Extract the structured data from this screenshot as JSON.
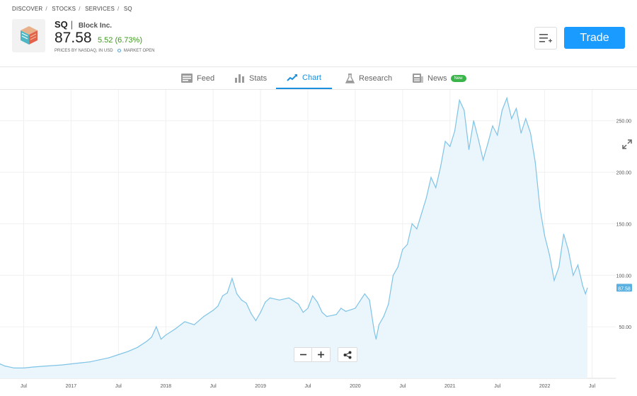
{
  "breadcrumb": [
    "DISCOVER",
    "STOCKS",
    "SERVICES",
    "SQ"
  ],
  "instrument": {
    "symbol": "SQ",
    "name": "Block Inc.",
    "price": "87.58",
    "change": "5.52 (6.73%)",
    "price_source": "PRICES BY NASDAQ, IN USD",
    "market_status": "MARKET OPEN"
  },
  "actions": {
    "trade_label": "Trade",
    "watchlist_icon": "add-to-list-icon"
  },
  "tabs": [
    {
      "label": "Feed",
      "icon": "feed-icon",
      "active": false
    },
    {
      "label": "Stats",
      "icon": "stats-icon",
      "active": false
    },
    {
      "label": "Chart",
      "icon": "chart-icon",
      "active": true
    },
    {
      "label": "Research",
      "icon": "research-icon",
      "active": false
    },
    {
      "label": "News",
      "icon": "news-icon",
      "active": false,
      "badge": "New"
    }
  ],
  "colors": {
    "accent": "#1a9bff",
    "positive": "#3d9a1d",
    "line": "#7fc3e6",
    "fill": "#eaf5fc",
    "badge": "#3ab54a"
  },
  "chart_data": {
    "type": "area",
    "x_unit": "year (decimal)",
    "x_ticks": [
      "Jul",
      "2017",
      "Jul",
      "2018",
      "Jul",
      "2019",
      "Jul",
      "2020",
      "Jul",
      "2021",
      "Jul",
      "2022",
      "Jul"
    ],
    "x_tick_values": [
      2016.5,
      2017.0,
      2017.5,
      2018.0,
      2018.5,
      2019.0,
      2019.5,
      2020.0,
      2020.5,
      2021.0,
      2021.5,
      2022.0,
      2022.5
    ],
    "y_ticks": [
      "50.00",
      "100.00",
      "150.00",
      "200.00",
      "250.00"
    ],
    "y_tick_values": [
      50,
      100,
      150,
      200,
      250
    ],
    "xlim": [
      2016.25,
      2022.75
    ],
    "ylim": [
      0,
      280
    ],
    "last_value_label": "87.58",
    "grid": true,
    "points": [
      [
        2016.25,
        14
      ],
      [
        2016.3,
        12
      ],
      [
        2016.4,
        10
      ],
      [
        2016.5,
        10
      ],
      [
        2016.6,
        11
      ],
      [
        2016.75,
        12
      ],
      [
        2016.9,
        13
      ],
      [
        2017.0,
        14
      ],
      [
        2017.1,
        15
      ],
      [
        2017.2,
        16
      ],
      [
        2017.3,
        18
      ],
      [
        2017.4,
        20
      ],
      [
        2017.5,
        23
      ],
      [
        2017.6,
        26
      ],
      [
        2017.7,
        30
      ],
      [
        2017.8,
        36
      ],
      [
        2017.85,
        40
      ],
      [
        2017.9,
        50
      ],
      [
        2017.95,
        38
      ],
      [
        2018.0,
        42
      ],
      [
        2018.1,
        48
      ],
      [
        2018.2,
        55
      ],
      [
        2018.3,
        52
      ],
      [
        2018.4,
        60
      ],
      [
        2018.5,
        66
      ],
      [
        2018.55,
        70
      ],
      [
        2018.6,
        80
      ],
      [
        2018.65,
        83
      ],
      [
        2018.7,
        97
      ],
      [
        2018.75,
        82
      ],
      [
        2018.8,
        76
      ],
      [
        2018.85,
        73
      ],
      [
        2018.9,
        63
      ],
      [
        2018.95,
        56
      ],
      [
        2019.0,
        64
      ],
      [
        2019.05,
        74
      ],
      [
        2019.1,
        78
      ],
      [
        2019.2,
        76
      ],
      [
        2019.3,
        78
      ],
      [
        2019.4,
        72
      ],
      [
        2019.45,
        64
      ],
      [
        2019.5,
        68
      ],
      [
        2019.55,
        80
      ],
      [
        2019.6,
        74
      ],
      [
        2019.65,
        64
      ],
      [
        2019.7,
        60
      ],
      [
        2019.8,
        62
      ],
      [
        2019.85,
        68
      ],
      [
        2019.9,
        65
      ],
      [
        2020.0,
        68
      ],
      [
        2020.05,
        75
      ],
      [
        2020.1,
        82
      ],
      [
        2020.15,
        76
      ],
      [
        2020.2,
        46
      ],
      [
        2020.22,
        38
      ],
      [
        2020.25,
        52
      ],
      [
        2020.3,
        60
      ],
      [
        2020.35,
        72
      ],
      [
        2020.4,
        100
      ],
      [
        2020.45,
        108
      ],
      [
        2020.5,
        125
      ],
      [
        2020.55,
        130
      ],
      [
        2020.6,
        150
      ],
      [
        2020.65,
        145
      ],
      [
        2020.7,
        160
      ],
      [
        2020.75,
        175
      ],
      [
        2020.8,
        195
      ],
      [
        2020.85,
        185
      ],
      [
        2020.9,
        205
      ],
      [
        2020.95,
        230
      ],
      [
        2021.0,
        225
      ],
      [
        2021.05,
        240
      ],
      [
        2021.1,
        270
      ],
      [
        2021.15,
        260
      ],
      [
        2021.2,
        222
      ],
      [
        2021.25,
        250
      ],
      [
        2021.3,
        232
      ],
      [
        2021.35,
        212
      ],
      [
        2021.4,
        228
      ],
      [
        2021.45,
        245
      ],
      [
        2021.5,
        236
      ],
      [
        2021.55,
        260
      ],
      [
        2021.6,
        272
      ],
      [
        2021.65,
        252
      ],
      [
        2021.7,
        262
      ],
      [
        2021.75,
        238
      ],
      [
        2021.8,
        252
      ],
      [
        2021.85,
        238
      ],
      [
        2021.9,
        210
      ],
      [
        2021.95,
        165
      ],
      [
        2022.0,
        138
      ],
      [
        2022.05,
        120
      ],
      [
        2022.1,
        95
      ],
      [
        2022.15,
        108
      ],
      [
        2022.2,
        140
      ],
      [
        2022.25,
        124
      ],
      [
        2022.3,
        100
      ],
      [
        2022.35,
        110
      ],
      [
        2022.4,
        90
      ],
      [
        2022.43,
        82
      ],
      [
        2022.45,
        87.58
      ]
    ]
  }
}
